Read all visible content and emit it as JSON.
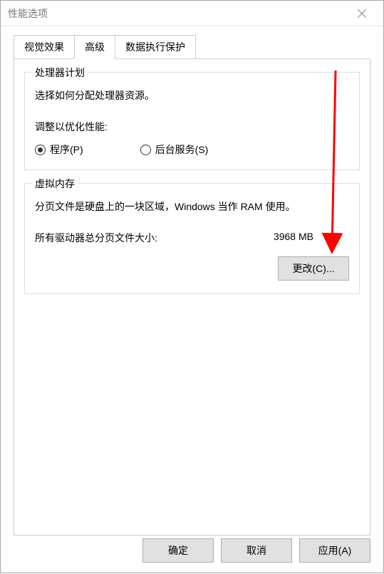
{
  "window": {
    "title": "性能选项"
  },
  "tabs": {
    "visual": "视觉效果",
    "advanced": "高级",
    "dep": "数据执行保护"
  },
  "processor": {
    "group_title": "处理器计划",
    "desc": "选择如何分配处理器资源。",
    "adjust_label": "调整以优化性能:",
    "radio_programs": "程序(P)",
    "radio_services": "后台服务(S)"
  },
  "vmemory": {
    "group_title": "虚拟内存",
    "desc": "分页文件是硬盘上的一块区域，Windows 当作 RAM 使用。",
    "total_label": "所有驱动器总分页文件大小:",
    "total_value": "3968 MB",
    "change_btn": "更改(C)..."
  },
  "footer": {
    "ok": "确定",
    "cancel": "取消",
    "apply": "应用(A)"
  }
}
